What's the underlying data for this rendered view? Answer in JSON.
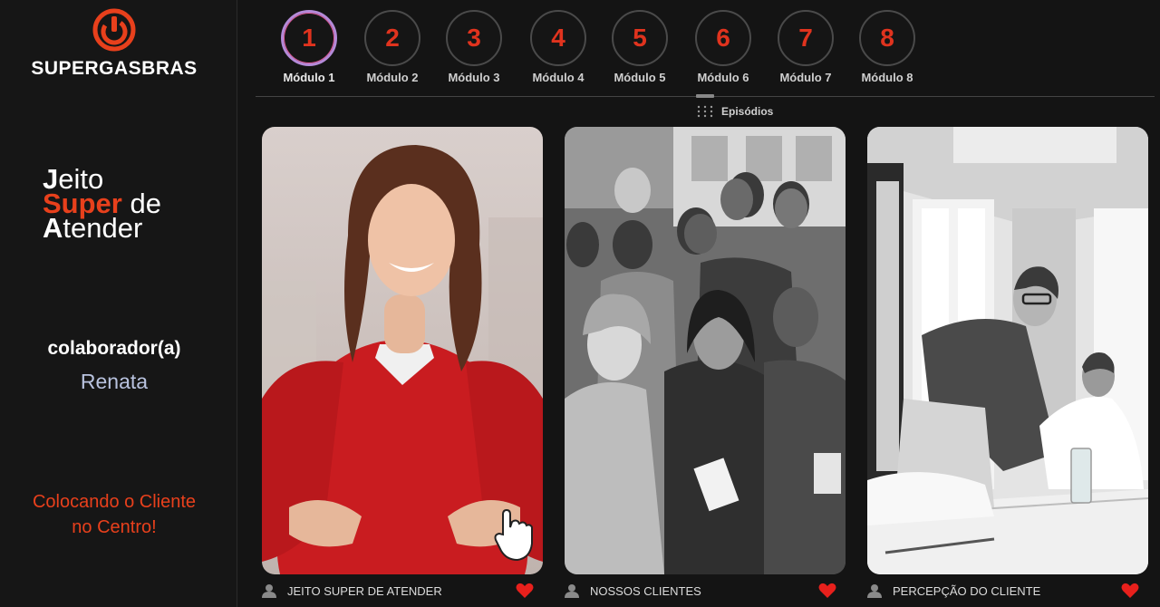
{
  "brand": {
    "name": "SUPERGASBRAS",
    "logo_icon": "power-icon",
    "accent_color": "#e8401c"
  },
  "tagline": {
    "l1_cap": "J",
    "l1_rest": "eito",
    "l2_cap": "Super",
    "l2_rest": " de",
    "l3_cap": "A",
    "l3_rest": "tender"
  },
  "collaborator": {
    "role_label": "colaborador(a)",
    "name": "Renata"
  },
  "slogan": {
    "line1": "Colocando o Cliente",
    "line2": "no Centro!"
  },
  "modules": [
    {
      "number": "1",
      "label": "Módulo 1",
      "active": true
    },
    {
      "number": "2",
      "label": "Módulo 2",
      "active": false
    },
    {
      "number": "3",
      "label": "Módulo 3",
      "active": false
    },
    {
      "number": "4",
      "label": "Módulo 4",
      "active": false
    },
    {
      "number": "5",
      "label": "Módulo 5",
      "active": false
    },
    {
      "number": "6",
      "label": "Módulo 6",
      "active": false
    },
    {
      "number": "7",
      "label": "Módulo 7",
      "active": false
    },
    {
      "number": "8",
      "label": "Módulo 8",
      "active": false
    }
  ],
  "episodes": {
    "label": "Episódios",
    "icon": "grid-dots-icon"
  },
  "cards": [
    {
      "title": "JEITO SUPER DE ATENDER",
      "user_icon": "user-icon",
      "heart_icon": "heart-icon",
      "heart_color": "#e8201c"
    },
    {
      "title": "NOSSOS CLIENTES",
      "user_icon": "user-icon",
      "heart_icon": "heart-icon",
      "heart_color": "#e8201c"
    },
    {
      "title": "PERCEPÇÃO DO CLIENTE",
      "user_icon": "user-icon",
      "heart_icon": "heart-icon",
      "heart_color": "#e8201c"
    }
  ]
}
